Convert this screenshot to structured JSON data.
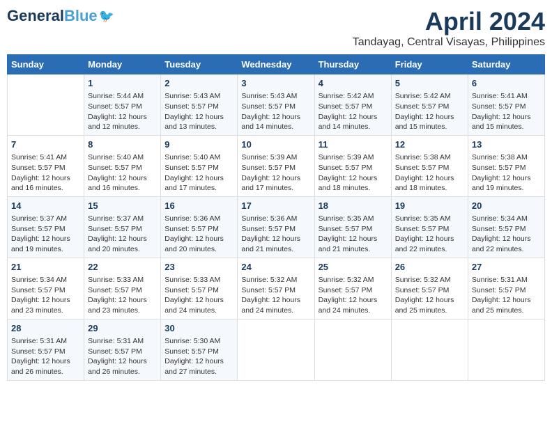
{
  "header": {
    "logo_general": "General",
    "logo_blue": "Blue",
    "month_year": "April 2024",
    "location": "Tandayag, Central Visayas, Philippines"
  },
  "days_of_week": [
    "Sunday",
    "Monday",
    "Tuesday",
    "Wednesday",
    "Thursday",
    "Friday",
    "Saturday"
  ],
  "weeks": [
    [
      {
        "day": "",
        "sunrise": "",
        "sunset": "",
        "daylight": ""
      },
      {
        "day": "1",
        "sunrise": "Sunrise: 5:44 AM",
        "sunset": "Sunset: 5:57 PM",
        "daylight": "Daylight: 12 hours and 12 minutes."
      },
      {
        "day": "2",
        "sunrise": "Sunrise: 5:43 AM",
        "sunset": "Sunset: 5:57 PM",
        "daylight": "Daylight: 12 hours and 13 minutes."
      },
      {
        "day": "3",
        "sunrise": "Sunrise: 5:43 AM",
        "sunset": "Sunset: 5:57 PM",
        "daylight": "Daylight: 12 hours and 14 minutes."
      },
      {
        "day": "4",
        "sunrise": "Sunrise: 5:42 AM",
        "sunset": "Sunset: 5:57 PM",
        "daylight": "Daylight: 12 hours and 14 minutes."
      },
      {
        "day": "5",
        "sunrise": "Sunrise: 5:42 AM",
        "sunset": "Sunset: 5:57 PM",
        "daylight": "Daylight: 12 hours and 15 minutes."
      },
      {
        "day": "6",
        "sunrise": "Sunrise: 5:41 AM",
        "sunset": "Sunset: 5:57 PM",
        "daylight": "Daylight: 12 hours and 15 minutes."
      }
    ],
    [
      {
        "day": "7",
        "sunrise": "Sunrise: 5:41 AM",
        "sunset": "Sunset: 5:57 PM",
        "daylight": "Daylight: 12 hours and 16 minutes."
      },
      {
        "day": "8",
        "sunrise": "Sunrise: 5:40 AM",
        "sunset": "Sunset: 5:57 PM",
        "daylight": "Daylight: 12 hours and 16 minutes."
      },
      {
        "day": "9",
        "sunrise": "Sunrise: 5:40 AM",
        "sunset": "Sunset: 5:57 PM",
        "daylight": "Daylight: 12 hours and 17 minutes."
      },
      {
        "day": "10",
        "sunrise": "Sunrise: 5:39 AM",
        "sunset": "Sunset: 5:57 PM",
        "daylight": "Daylight: 12 hours and 17 minutes."
      },
      {
        "day": "11",
        "sunrise": "Sunrise: 5:39 AM",
        "sunset": "Sunset: 5:57 PM",
        "daylight": "Daylight: 12 hours and 18 minutes."
      },
      {
        "day": "12",
        "sunrise": "Sunrise: 5:38 AM",
        "sunset": "Sunset: 5:57 PM",
        "daylight": "Daylight: 12 hours and 18 minutes."
      },
      {
        "day": "13",
        "sunrise": "Sunrise: 5:38 AM",
        "sunset": "Sunset: 5:57 PM",
        "daylight": "Daylight: 12 hours and 19 minutes."
      }
    ],
    [
      {
        "day": "14",
        "sunrise": "Sunrise: 5:37 AM",
        "sunset": "Sunset: 5:57 PM",
        "daylight": "Daylight: 12 hours and 19 minutes."
      },
      {
        "day": "15",
        "sunrise": "Sunrise: 5:37 AM",
        "sunset": "Sunset: 5:57 PM",
        "daylight": "Daylight: 12 hours and 20 minutes."
      },
      {
        "day": "16",
        "sunrise": "Sunrise: 5:36 AM",
        "sunset": "Sunset: 5:57 PM",
        "daylight": "Daylight: 12 hours and 20 minutes."
      },
      {
        "day": "17",
        "sunrise": "Sunrise: 5:36 AM",
        "sunset": "Sunset: 5:57 PM",
        "daylight": "Daylight: 12 hours and 21 minutes."
      },
      {
        "day": "18",
        "sunrise": "Sunrise: 5:35 AM",
        "sunset": "Sunset: 5:57 PM",
        "daylight": "Daylight: 12 hours and 21 minutes."
      },
      {
        "day": "19",
        "sunrise": "Sunrise: 5:35 AM",
        "sunset": "Sunset: 5:57 PM",
        "daylight": "Daylight: 12 hours and 22 minutes."
      },
      {
        "day": "20",
        "sunrise": "Sunrise: 5:34 AM",
        "sunset": "Sunset: 5:57 PM",
        "daylight": "Daylight: 12 hours and 22 minutes."
      }
    ],
    [
      {
        "day": "21",
        "sunrise": "Sunrise: 5:34 AM",
        "sunset": "Sunset: 5:57 PM",
        "daylight": "Daylight: 12 hours and 23 minutes."
      },
      {
        "day": "22",
        "sunrise": "Sunrise: 5:33 AM",
        "sunset": "Sunset: 5:57 PM",
        "daylight": "Daylight: 12 hours and 23 minutes."
      },
      {
        "day": "23",
        "sunrise": "Sunrise: 5:33 AM",
        "sunset": "Sunset: 5:57 PM",
        "daylight": "Daylight: 12 hours and 24 minutes."
      },
      {
        "day": "24",
        "sunrise": "Sunrise: 5:32 AM",
        "sunset": "Sunset: 5:57 PM",
        "daylight": "Daylight: 12 hours and 24 minutes."
      },
      {
        "day": "25",
        "sunrise": "Sunrise: 5:32 AM",
        "sunset": "Sunset: 5:57 PM",
        "daylight": "Daylight: 12 hours and 24 minutes."
      },
      {
        "day": "26",
        "sunrise": "Sunrise: 5:32 AM",
        "sunset": "Sunset: 5:57 PM",
        "daylight": "Daylight: 12 hours and 25 minutes."
      },
      {
        "day": "27",
        "sunrise": "Sunrise: 5:31 AM",
        "sunset": "Sunset: 5:57 PM",
        "daylight": "Daylight: 12 hours and 25 minutes."
      }
    ],
    [
      {
        "day": "28",
        "sunrise": "Sunrise: 5:31 AM",
        "sunset": "Sunset: 5:57 PM",
        "daylight": "Daylight: 12 hours and 26 minutes."
      },
      {
        "day": "29",
        "sunrise": "Sunrise: 5:31 AM",
        "sunset": "Sunset: 5:57 PM",
        "daylight": "Daylight: 12 hours and 26 minutes."
      },
      {
        "day": "30",
        "sunrise": "Sunrise: 5:30 AM",
        "sunset": "Sunset: 5:57 PM",
        "daylight": "Daylight: 12 hours and 27 minutes."
      },
      {
        "day": "",
        "sunrise": "",
        "sunset": "",
        "daylight": ""
      },
      {
        "day": "",
        "sunrise": "",
        "sunset": "",
        "daylight": ""
      },
      {
        "day": "",
        "sunrise": "",
        "sunset": "",
        "daylight": ""
      },
      {
        "day": "",
        "sunrise": "",
        "sunset": "",
        "daylight": ""
      }
    ]
  ]
}
